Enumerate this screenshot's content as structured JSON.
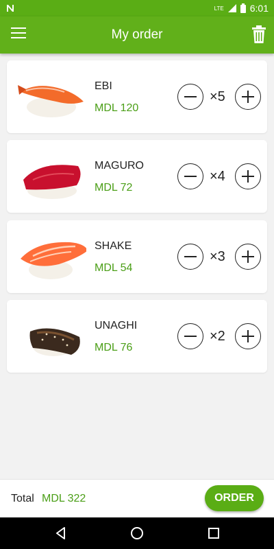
{
  "status_bar": {
    "time": "6:01",
    "network": "LTE"
  },
  "app_bar": {
    "title": "My order"
  },
  "items": [
    {
      "name": "EBI",
      "price": "MDL 120",
      "qty": "×5"
    },
    {
      "name": "MAGURO",
      "price": "MDL 72",
      "qty": "×4"
    },
    {
      "name": "SHAKE",
      "price": "MDL 54",
      "qty": "×3"
    },
    {
      "name": "UNAGHI",
      "price": "MDL 76",
      "qty": "×2"
    }
  ],
  "footer": {
    "total_label": "Total",
    "total_value": "MDL 322",
    "order_label": "ORDER"
  },
  "colors": {
    "primary": "#61b01a",
    "accent_text": "#4a9e16",
    "background": "#f2f2f2"
  },
  "icons": [
    "notification-icon",
    "signal-icon",
    "battery-icon",
    "menu-icon",
    "trash-icon",
    "back-icon",
    "home-icon",
    "recents-icon"
  ]
}
